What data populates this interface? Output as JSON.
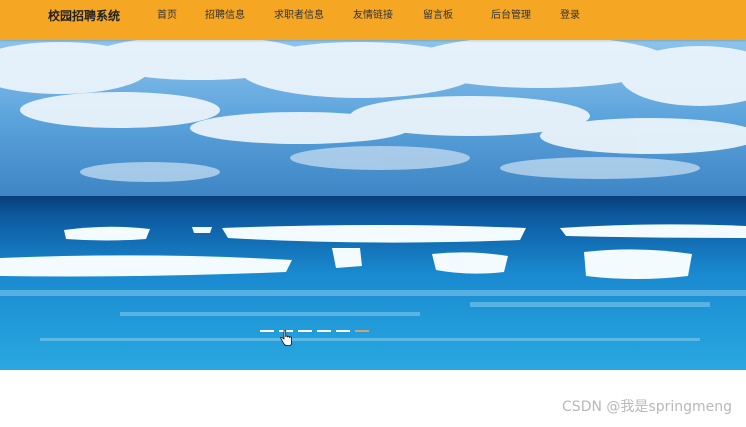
{
  "navbar": {
    "brand": "校园招聘系统",
    "items": [
      {
        "label": "首页"
      },
      {
        "label": "招聘信息"
      },
      {
        "label": "求职者信息"
      },
      {
        "label": "友情链接"
      },
      {
        "label": "留言板"
      },
      {
        "label": "后台管理"
      },
      {
        "label": "登录"
      }
    ],
    "accent_color": "#f5a623"
  },
  "banner": {
    "image": "ocean-sky-illustration",
    "slide_count": 6,
    "active_slide": 6
  },
  "watermark": "CSDN @我是springmeng",
  "icons": {
    "cursor": "hand-pointer-icon"
  }
}
